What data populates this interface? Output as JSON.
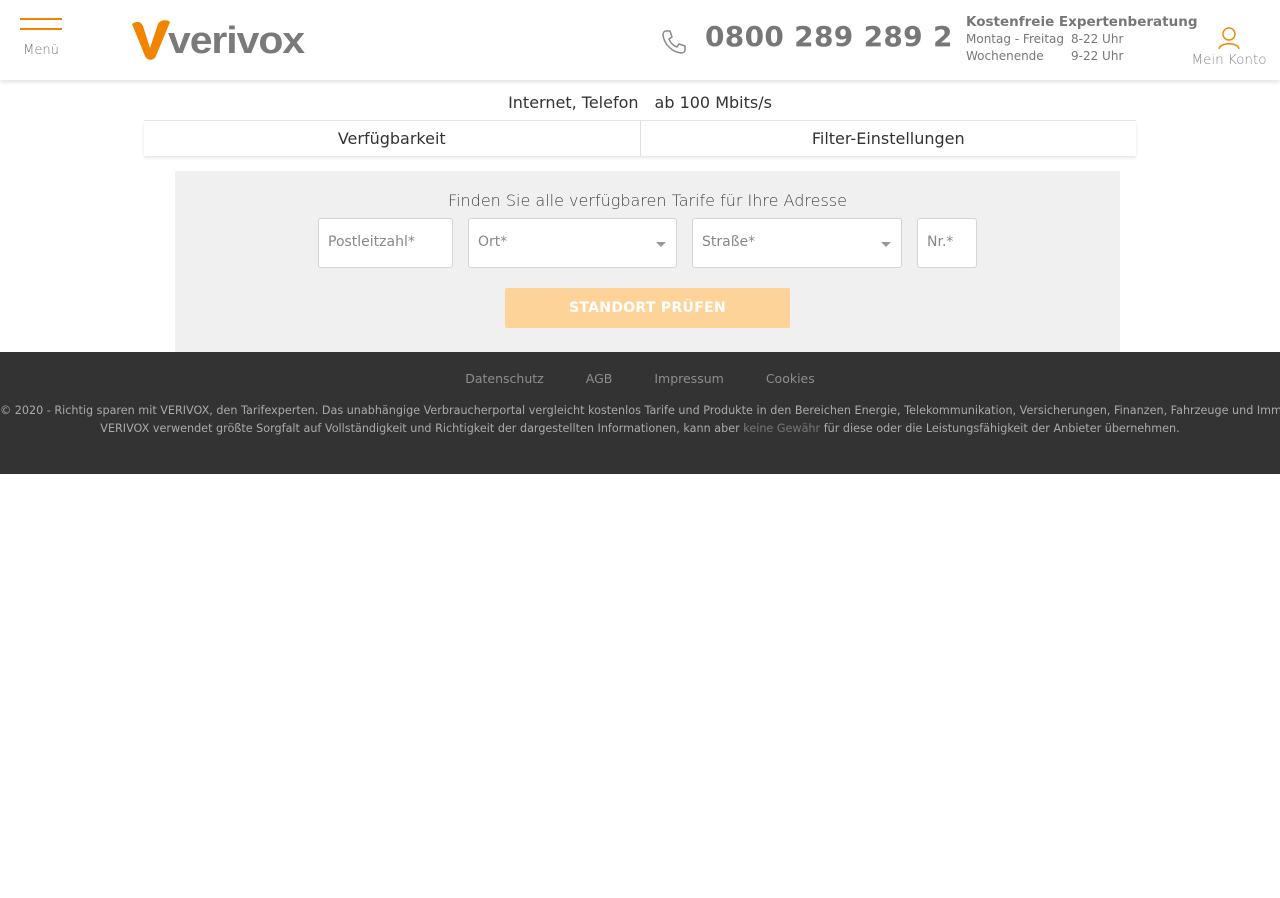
{
  "header": {
    "menu_label": "Menü",
    "logo_text": "verivox",
    "phone": "0800 289 289 2",
    "hotline": {
      "title": "Kostenfreie Expertenberatung",
      "rows": [
        {
          "day": "Montag - Freitag",
          "hours": "8-22 Uhr"
        },
        {
          "day": "Wochenende",
          "hours": "9-22 Uhr"
        }
      ]
    },
    "account_label": "Mein Konto"
  },
  "summary": {
    "product": "Internet, Telefon",
    "speed": "ab 100 Mbits/s"
  },
  "tabs": [
    {
      "label": "Verfügbarkeit"
    },
    {
      "label": "Filter-Einstellungen"
    }
  ],
  "search": {
    "title": "Finden Sie alle verfügbaren Tarife für Ihre Adresse",
    "plz_placeholder": "Postleitzahl*",
    "ort_placeholder": "Ort*",
    "strasse_placeholder": "Straße*",
    "nr_placeholder": "Nr.*",
    "submit_label": "STANDORT PRÜFEN"
  },
  "footer": {
    "links": [
      "Datenschutz",
      "AGB",
      "Impressum",
      "Cookies"
    ],
    "line1": "© 2020 - Richtig sparen mit VERIVOX, den Tarifexperten. Das unabhängige Verbraucherportal vergleicht kostenlos Tarife und Produkte in den Bereichen Energie, Telekommunikation, Versicherungen, Finanzen, Fahrzeuge und Immobilien.",
    "line2_before": "VERIVOX verwendet größte Sorgfalt auf Vollständigkeit und Richtigkeit der dargestellten Informationen, kann aber",
    "line2_link": "keine Gewähr",
    "line2_after": "für diese oder die Leistungsfähigkeit der Anbieter übernehmen."
  },
  "colors": {
    "brand_orange": "#f18400",
    "button_disabled": "#fdd399",
    "panel_bg": "#f0f0f0",
    "footer_bg": "#333333"
  },
  "icons": {
    "menu": "hamburger-icon",
    "phone": "phone-icon",
    "account": "user-icon",
    "dropdown": "caret-down-icon"
  }
}
